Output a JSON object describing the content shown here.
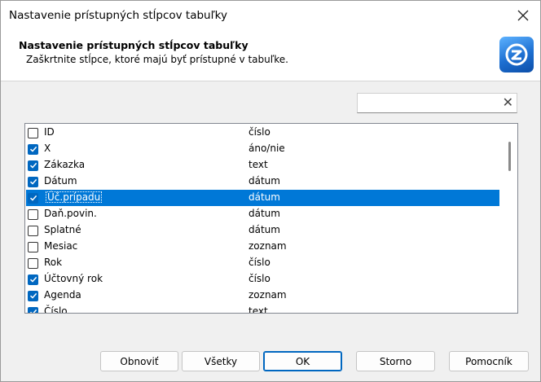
{
  "window": {
    "title": "Nastavenie prístupných stĺpcov tabuľky"
  },
  "header": {
    "title": "Nastavenie prístupných stĺpcov tabuľky",
    "subtitle": "Zaškrtnite stĺpce, ktoré majú byť prístupné v tabuľke."
  },
  "search": {
    "value": "",
    "placeholder": ""
  },
  "columns": [
    {
      "name": "ID",
      "type": "číslo",
      "checked": false,
      "selected": false
    },
    {
      "name": "X",
      "type": "áno/nie",
      "checked": true,
      "selected": false
    },
    {
      "name": "Zákazka",
      "type": "text",
      "checked": true,
      "selected": false
    },
    {
      "name": "Dátum",
      "type": "dátum",
      "checked": true,
      "selected": false
    },
    {
      "name": "Úč.prípadu",
      "type": "dátum",
      "checked": true,
      "selected": true
    },
    {
      "name": "Daň.povin.",
      "type": "dátum",
      "checked": false,
      "selected": false
    },
    {
      "name": "Splatné",
      "type": "dátum",
      "checked": false,
      "selected": false
    },
    {
      "name": "Mesiac",
      "type": "zoznam",
      "checked": false,
      "selected": false
    },
    {
      "name": "Rok",
      "type": "číslo",
      "checked": false,
      "selected": false
    },
    {
      "name": "Účtovný rok",
      "type": "číslo",
      "checked": true,
      "selected": false
    },
    {
      "name": "Agenda",
      "type": "zoznam",
      "checked": true,
      "selected": false
    },
    {
      "name": "Číslo",
      "type": "text",
      "checked": true,
      "selected": false
    }
  ],
  "buttons": {
    "refresh": "Obnoviť",
    "all": "Všetky",
    "ok": "OK",
    "cancel": "Storno",
    "help": "Pomocník"
  },
  "colors": {
    "accent": "#0078d7",
    "checkbox": "#0067c0"
  },
  "icons": {
    "close": "close-icon",
    "logo": "app-logo-icon",
    "clear": "clear-search-icon",
    "check": "checkmark-icon"
  }
}
